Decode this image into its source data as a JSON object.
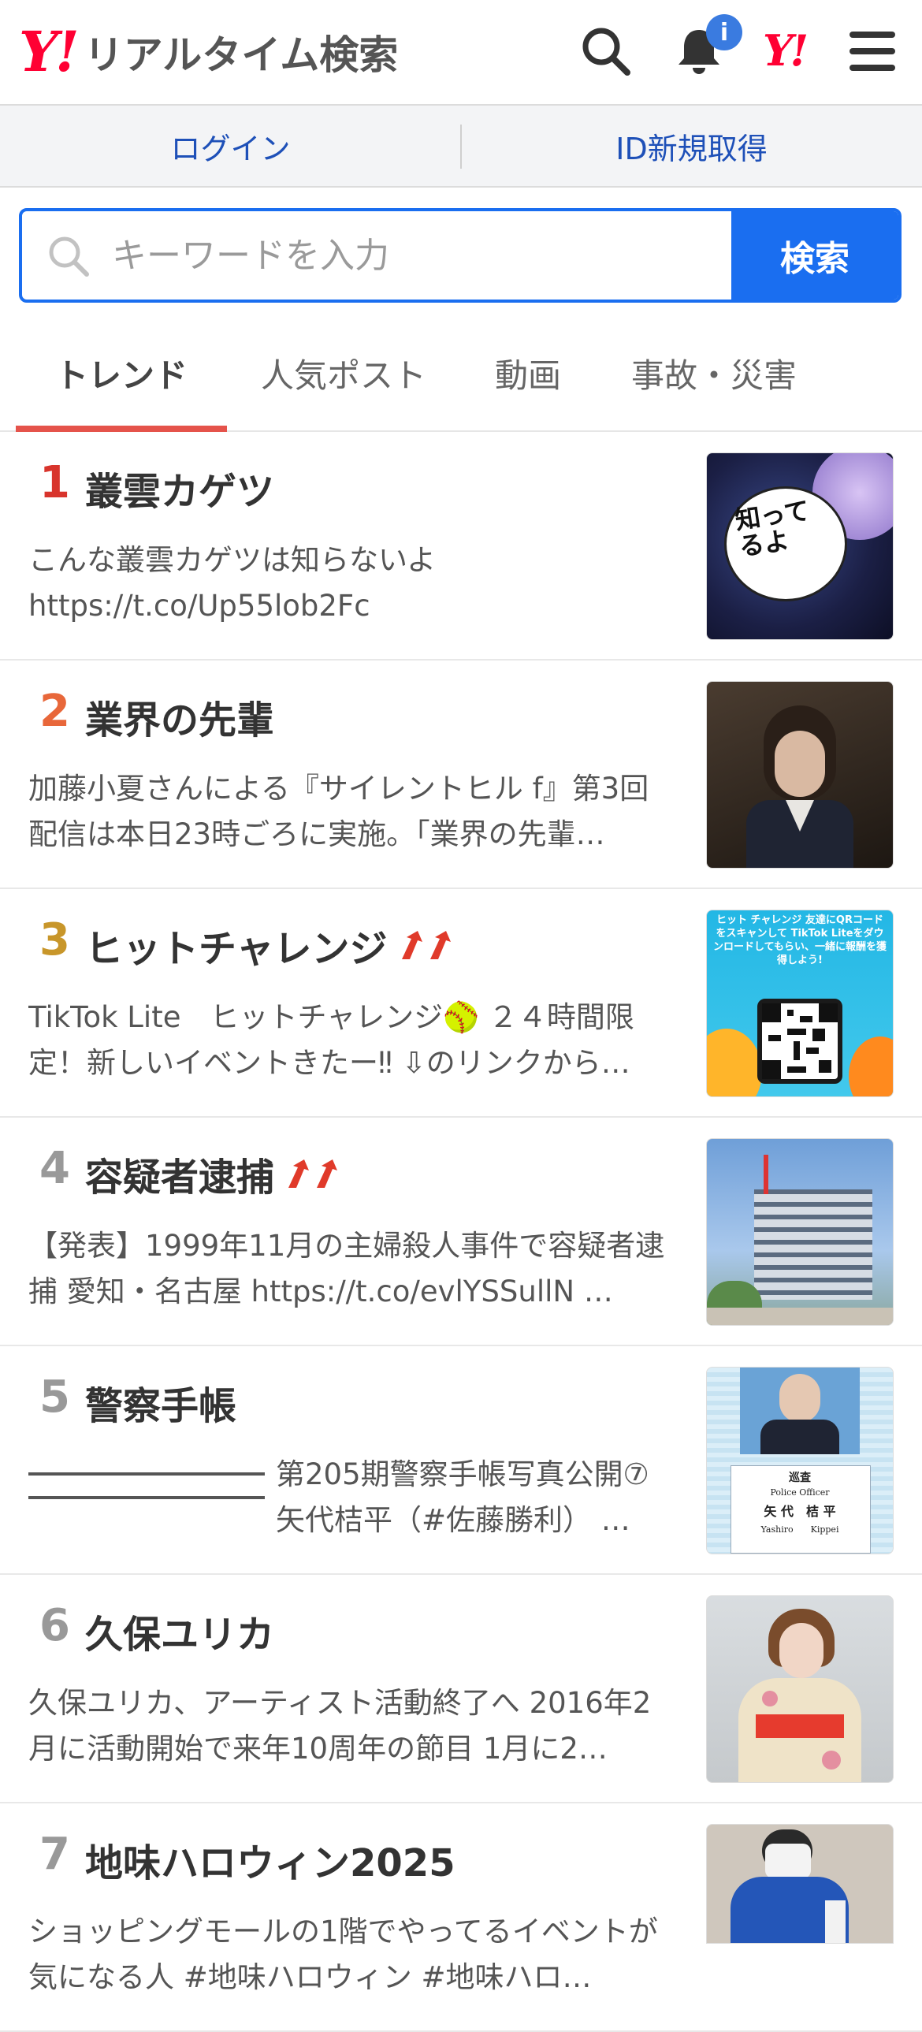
{
  "header": {
    "logo_y": "Y!",
    "logo_text": "リアルタイム検索",
    "notification_badge": "i",
    "yahoo_mark": "Y!"
  },
  "login_bar": {
    "login": "ログイン",
    "register": "ID新規取得"
  },
  "search": {
    "placeholder": "キーワードを入力",
    "button": "検索"
  },
  "tabs": [
    {
      "label": "トレンド",
      "active": true
    },
    {
      "label": "人気ポスト"
    },
    {
      "label": "動画"
    },
    {
      "label": "事故・災害"
    }
  ],
  "trends": [
    {
      "rank": "1",
      "title": "叢雲カゲツ",
      "rising": false,
      "desc": "こんな叢雲カゲツは知らないよ https://t.co/Up55lob2Fc",
      "thumb": "知ってるよ"
    },
    {
      "rank": "2",
      "title": "業界の先輩",
      "rising": false,
      "desc": "加藤小夏さんによる『サイレントヒル f』第3回配信は本日23時ごろに実施。｢業界の先輩…"
    },
    {
      "rank": "3",
      "title": "ヒットチャレンジ",
      "rising": true,
      "desc": "TikTok Lite　ヒットチャレンジ🥎 ２４時間限定！新しいイベントきたー‼ ⇩のリンクから…",
      "thumb": "ヒット チャレンジ 友達にQRコードをスキャンして TikTok Liteをダウンロードしてもらい、一緒に報酬を獲得しよう!"
    },
    {
      "rank": "4",
      "title": "容疑者逮捕",
      "rising": true,
      "desc": "【発表】1999年11月の主婦殺人事件で容疑者逮捕 愛知・名古屋 https://t.co/evlYSSullN …"
    },
    {
      "rank": "5",
      "title": "警察手帳",
      "rising": false,
      "desc_a": "第205期警察手帳写真公開⑦",
      "desc_b": "矢代桔平（#佐藤勝利） …",
      "thumb_lines": [
        "巡査",
        "Police Officer",
        "矢 代　桔 平",
        "Yashiro　　Kippei"
      ]
    },
    {
      "rank": "6",
      "title": "久保ユリカ",
      "rising": false,
      "desc": "久保ユリカ、アーティスト活動終了へ 2016年2月に活動開始で来年10周年の節目 1月に2…"
    },
    {
      "rank": "7",
      "title": "地味ハロウィン2025",
      "rising": false,
      "desc": "ショッピングモールの1階でやってるイベントが気になる人 #地味ハロウィン #地味ハロ…"
    }
  ],
  "colors": {
    "accent": "#1a6ef0",
    "brand": "#ff0033",
    "tab_underline": "#e5534b"
  }
}
